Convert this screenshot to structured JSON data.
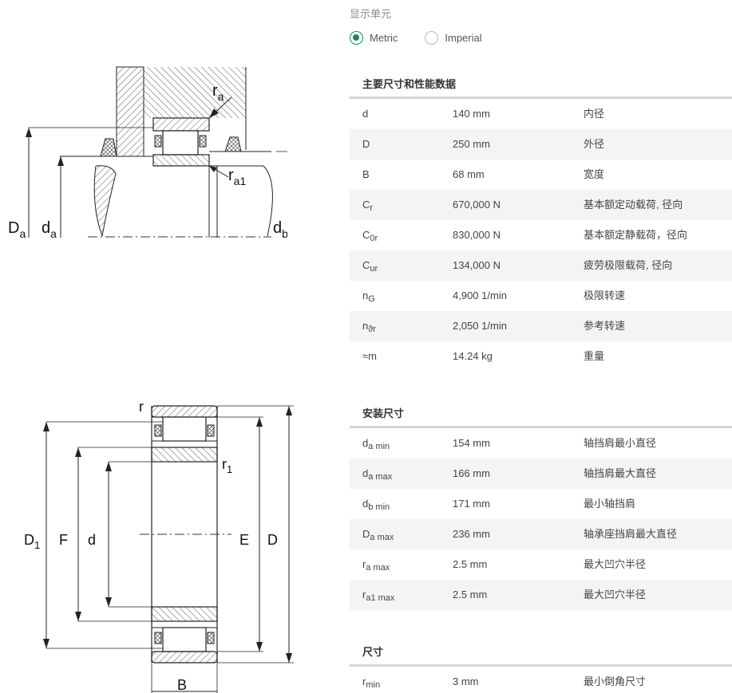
{
  "unit_selector": {
    "label": "显示单元",
    "options": [
      {
        "label": "Metric",
        "selected": true
      },
      {
        "label": "Imperial",
        "selected": false
      }
    ],
    "accent_color": "#1c8a52"
  },
  "diagram_top": {
    "labels": {
      "ra": "r",
      "ra_sub": "a",
      "ra1": "r",
      "ra1_sub": "a1",
      "Da": "D",
      "Da_sub": "a",
      "da": "d",
      "da_sub": "a",
      "db": "d",
      "db_sub": "b"
    }
  },
  "diagram_bottom": {
    "labels": {
      "r": "r",
      "r1": "r",
      "r1_sub": "1",
      "D1": "D",
      "D1_sub": "1",
      "F": "F",
      "d": "d",
      "E": "E",
      "D": "D",
      "B": "B"
    }
  },
  "sections": [
    {
      "title": "主要尺寸和性能数据",
      "rows": [
        {
          "sym": "d",
          "sub": "",
          "value": "140 mm",
          "desc": "内径"
        },
        {
          "sym": "D",
          "sub": "",
          "value": "250 mm",
          "desc": "外径"
        },
        {
          "sym": "B",
          "sub": "",
          "value": "68 mm",
          "desc": "宽度"
        },
        {
          "sym": "C",
          "sub": "r",
          "value": "670,000 N",
          "desc": "基本额定动载荷, 径向"
        },
        {
          "sym": "C",
          "sub": "0r",
          "value": "830,000 N",
          "desc": "基本额定静载荷，径向"
        },
        {
          "sym": "C",
          "sub": "ur",
          "value": "134,000 N",
          "desc": "疲劳极限载荷, 径向"
        },
        {
          "sym": "n",
          "sub": "G",
          "value": "4,900 1/min",
          "desc": "极限转速"
        },
        {
          "sym": "n",
          "sub": "ϑr",
          "value": "2,050 1/min",
          "desc": "参考转速"
        },
        {
          "sym": "≈m",
          "sub": "",
          "value": "14.24 kg",
          "desc": "重量"
        }
      ]
    },
    {
      "title": "安装尺寸",
      "rows": [
        {
          "sym": "d",
          "sub": "a min",
          "value": "154 mm",
          "desc": "轴挡肩最小直径"
        },
        {
          "sym": "d",
          "sub": "a max",
          "value": "166 mm",
          "desc": "轴挡肩最大直径"
        },
        {
          "sym": "d",
          "sub": "b min",
          "value": "171 mm",
          "desc": "最小轴挡肩"
        },
        {
          "sym": "D",
          "sub": "a max",
          "value": "236 mm",
          "desc": "轴承座挡肩最大直径"
        },
        {
          "sym": "r",
          "sub": "a max",
          "value": "2.5 mm",
          "desc": "最大凹穴半径"
        },
        {
          "sym": "r",
          "sub": "a1 max",
          "value": "2.5 mm",
          "desc": "最大凹穴半径"
        }
      ]
    },
    {
      "title": "尺寸",
      "rows": [
        {
          "sym": "r",
          "sub": "min",
          "value": "3 mm",
          "desc": "最小倒角尺寸"
        }
      ]
    }
  ]
}
